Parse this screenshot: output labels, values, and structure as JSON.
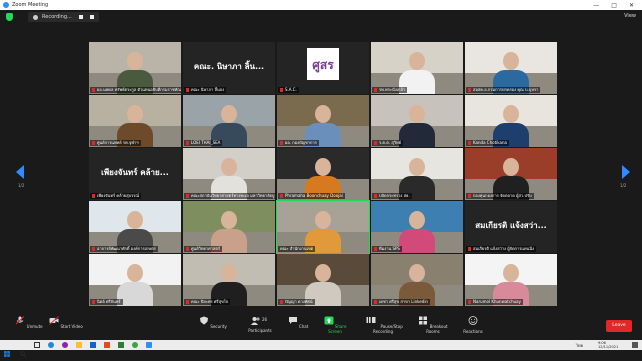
{
  "window": {
    "title": "Zoom Meeting",
    "controls": [
      "—",
      "□",
      "✕"
    ]
  },
  "topbar": {
    "recording": "Recording...",
    "view": "View"
  },
  "nav": {
    "left_page": "1/2",
    "right_page": "1/2"
  },
  "tiles": [
    {
      "name": "ผอ.นพดล ทรัพย์ตระกูล ตัวแทนอธิบดีกรมราชทัณฑ์",
      "type": "video",
      "bg": "#b9b3a8",
      "shirt": "#4a5a3e",
      "muted": true
    },
    {
      "name": "คณะ นิษาภา ลิ้นจง",
      "big": "คณะ. นิษาภา ลิ้น...",
      "type": "name",
      "muted": true
    },
    {
      "name": "S.A.C.",
      "type": "logo",
      "logo": "ศูสร",
      "muted": true
    },
    {
      "name": "รพ.พระนั่งเกล้า",
      "type": "video",
      "bg": "#d6d2c7",
      "shirt": "#f2f2f2",
      "muted": true
    },
    {
      "name": "สอสค.อ.กรมการปกครอง คุณ บ.บุษรา",
      "type": "video",
      "bg": "#e9e6e1",
      "shirt": "#2b6aa1",
      "muted": true
    },
    {
      "name": "ศูนย์การแพทย์ รพ.จุฬาฯ",
      "type": "video",
      "bg": "#b8b0a0",
      "shirt": "#6d4b2a",
      "muted": true
    },
    {
      "name": "LOEI THAI_SEA",
      "type": "video",
      "bg": "#9aa3a8",
      "shirt": "#374a5b",
      "muted": true
    },
    {
      "name": "ผอ. กองบัญชาการ",
      "type": "video",
      "bg": "#7a6a4e",
      "shirt": "#6a8fbb",
      "muted": true
    },
    {
      "name": "ร.ต.ต. สุวิทย์",
      "type": "video",
      "bg": "#c7c2bb",
      "shirt": "#222a3a",
      "muted": true
    },
    {
      "name": "Kanda Chotikana",
      "type": "video",
      "bg": "#e8e4de",
      "shirt": "#1e3e6e",
      "muted": true
    },
    {
      "name": "เพียงจันทร์ คล้ายสุบรรณ์",
      "big": "เพียงจันทร์ คล้าย...",
      "type": "name",
      "muted": true
    },
    {
      "name": "คณะสถาบันวิทยาศาสตร์ทางทะเล มหาวิทยาลัยบูรพา",
      "type": "video",
      "bg": "#d2cfc8",
      "shirt": "#e3e1dc",
      "muted": true
    },
    {
      "name": "Phramaha Boonchuay Doojai",
      "type": "video",
      "bg": "#2a2a2a",
      "shirt": "#d77a1f",
      "muted": true
    },
    {
      "name": "ปลัดกระทรวง สธ.",
      "type": "video",
      "bg": "#e7e5e0",
      "shirt": "#2a2a2a",
      "muted": true
    },
    {
      "name": "กองทุนกองการ จัดตลาด ผู้สว.ปรับ",
      "type": "video",
      "bg": "#9a3e2a",
      "shirt": "#202020",
      "muted": true
    },
    {
      "name": "อาจารย์พัฒนาศักดิ์ องค์การเกษตร",
      "type": "video",
      "bg": "#dfe6ec",
      "shirt": "#4a4a4a",
      "muted": true
    },
    {
      "name": "ศูนย์วิทยาศาสตร์",
      "type": "video",
      "bg": "#7e8e5e",
      "shirt": "#c9a08a",
      "muted": true
    },
    {
      "name": "คณะ สำนักงานเขต",
      "type": "video",
      "bg": "#a8a296",
      "shirt": "#e09a3a",
      "muted": false,
      "active": true
    },
    {
      "name": "ทีมงาน SPS",
      "type": "video",
      "bg": "#3d7fb0",
      "shirt": "#d14a7a",
      "muted": true
    },
    {
      "name": "สมเกียรติ แจ้งสว่าง ผู้จัดการแคนนิ่ง",
      "big": "สมเกียรติ แจ้งสว่า...",
      "type": "name",
      "muted": true
    },
    {
      "name": "นิตย์ ศรีจันทร์",
      "type": "video",
      "bg": "#f2f2f2",
      "shirt": "#d8d8d8",
      "muted": true
    },
    {
      "name": "คณะ ปิยะพร ศรีสุขใจ",
      "type": "video",
      "bg": "#c2bdb2",
      "shirt": "#1f1f1f",
      "muted": true
    },
    {
      "name": "ปัญญา ดวงทัศน์",
      "type": "video",
      "bg": "#5a4a3a",
      "shirt": "#cfc9bf",
      "muted": true
    },
    {
      "name": "เดชา ศรีสุข สาขา Linkedin",
      "type": "video",
      "bg": "#8a8070",
      "shirt": "#7a5a3a",
      "muted": true
    },
    {
      "name": "Narumol Khunwatchuay",
      "type": "video",
      "bg": "#f4f4f4",
      "shirt": "#d98a9a",
      "muted": true
    }
  ],
  "toolbar": {
    "unmute": "Unmute",
    "start_video": "Start Video",
    "security": "Security",
    "participants": "Participants",
    "participants_count": "26",
    "chat": "Chat",
    "share": "Share Screen",
    "pause": "Pause/Stop Recording",
    "breakout": "Breakout Rooms",
    "reactions": "Reactions",
    "leave": "Leave"
  },
  "taskbar": {
    "lang": "ไทย",
    "time": "9:06",
    "date": "12/11/2021"
  },
  "colors": {
    "accent": "#2d8cff",
    "leave": "#e02828",
    "share": "#23d959"
  }
}
